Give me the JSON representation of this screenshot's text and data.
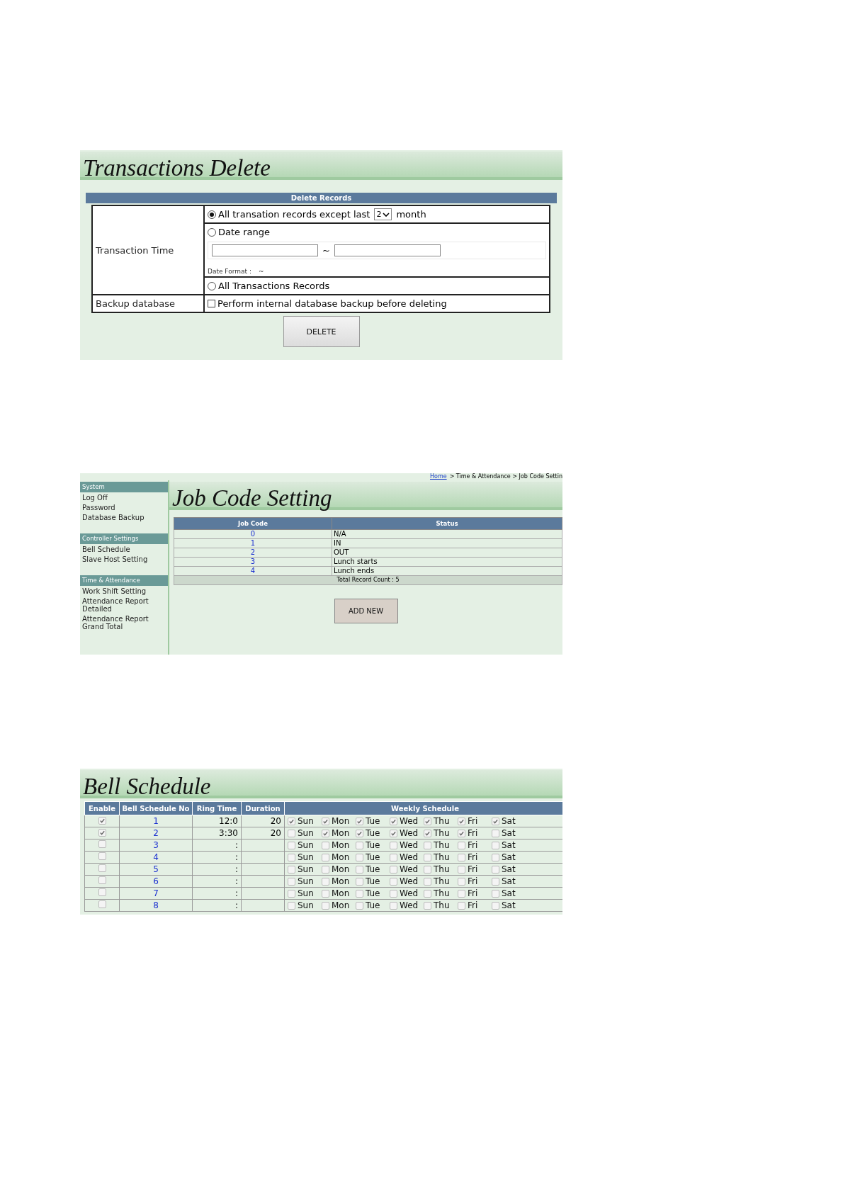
{
  "transactions_delete": {
    "title": "Transactions Delete",
    "header": "Delete Records",
    "time_label": "Transaction Time",
    "options": [
      {
        "kind": "months",
        "label": "All transation records except last",
        "select_value": "2",
        "label_after": "month",
        "selected": true
      },
      {
        "kind": "range",
        "label": "Date range",
        "separator": "~",
        "format_label": "Date Format :",
        "format_value": "~",
        "selected": false
      },
      {
        "kind": "plain",
        "label": "All Transactions Records",
        "selected": false
      }
    ],
    "backup": {
      "label": "Backup database",
      "checkbox_label": "Perform internal database backup before deleting",
      "checked": false
    },
    "button": "DELETE"
  },
  "job_code_setting": {
    "breadcrumb": {
      "home": "Home",
      "path": "> Time & Attendance > Job Code Settin"
    },
    "sidebar": [
      {
        "title": "System",
        "items": [
          "Log Off",
          "Password",
          "Database Backup"
        ]
      },
      {
        "title": "Controller Settings",
        "items": [
          "Bell Schedule",
          "Slave Host Setting"
        ]
      },
      {
        "title": "Time & Attendance",
        "items": [
          "Work Shift Setting",
          "Attendance Report Detailed",
          "Attendance Report Grand Total"
        ]
      }
    ],
    "title": "Job Code Setting",
    "columns": [
      "Job Code",
      "Status"
    ],
    "rows": [
      {
        "code": "0",
        "status": "N/A"
      },
      {
        "code": "1",
        "status": "IN"
      },
      {
        "code": "2",
        "status": "OUT"
      },
      {
        "code": "3",
        "status": "Lunch starts"
      },
      {
        "code": "4",
        "status": "Lunch ends"
      }
    ],
    "footer": "Total Record Count : 5",
    "button": "ADD NEW"
  },
  "bell_schedule": {
    "title": "Bell Schedule",
    "columns": [
      "Enable",
      "Bell Schedule No",
      "Ring Time",
      "Duration",
      "Weekly Schedule"
    ],
    "rows": [
      {
        "enabled": true,
        "no": "1",
        "ring_time": "12:0",
        "duration": "20",
        "days": [
          {
            "label": "Sun",
            "checked": true
          },
          {
            "label": "Mon",
            "checked": true
          },
          {
            "label": "Tue",
            "checked": true
          },
          {
            "label": "Wed",
            "checked": true
          },
          {
            "label": "Thu",
            "checked": true
          },
          {
            "label": "Fri",
            "checked": true
          },
          {
            "label": "Sat",
            "checked": true
          }
        ]
      },
      {
        "enabled": true,
        "no": "2",
        "ring_time": "3:30",
        "duration": "20",
        "days": [
          {
            "label": "Sun",
            "checked": false
          },
          {
            "label": "Mon",
            "checked": true
          },
          {
            "label": "Tue",
            "checked": true
          },
          {
            "label": "Wed",
            "checked": true
          },
          {
            "label": "Thu",
            "checked": true
          },
          {
            "label": "Fri",
            "checked": true
          },
          {
            "label": "Sat",
            "checked": false
          }
        ]
      },
      {
        "enabled": false,
        "no": "3",
        "ring_time": ":",
        "days": [
          {
            "label": "Sun",
            "checked": false
          },
          {
            "label": "Mon",
            "checked": false
          },
          {
            "label": "Tue",
            "checked": false
          },
          {
            "label": "Wed",
            "checked": false
          },
          {
            "label": "Thu",
            "checked": false
          },
          {
            "label": "Fri",
            "checked": false
          },
          {
            "label": "Sat",
            "checked": false
          }
        ]
      },
      {
        "enabled": false,
        "no": "4",
        "ring_time": ":",
        "days": [
          {
            "label": "Sun",
            "checked": false
          },
          {
            "label": "Mon",
            "checked": false
          },
          {
            "label": "Tue",
            "checked": false
          },
          {
            "label": "Wed",
            "checked": false
          },
          {
            "label": "Thu",
            "checked": false
          },
          {
            "label": "Fri",
            "checked": false
          },
          {
            "label": "Sat",
            "checked": false
          }
        ]
      },
      {
        "enabled": false,
        "no": "5",
        "ring_time": ":",
        "days": [
          {
            "label": "Sun",
            "checked": false
          },
          {
            "label": "Mon",
            "checked": false
          },
          {
            "label": "Tue",
            "checked": false
          },
          {
            "label": "Wed",
            "checked": false
          },
          {
            "label": "Thu",
            "checked": false
          },
          {
            "label": "Fri",
            "checked": false
          },
          {
            "label": "Sat",
            "checked": false
          }
        ]
      },
      {
        "enabled": false,
        "no": "6",
        "ring_time": ":",
        "days": [
          {
            "label": "Sun",
            "checked": false
          },
          {
            "label": "Mon",
            "checked": false
          },
          {
            "label": "Tue",
            "checked": false
          },
          {
            "label": "Wed",
            "checked": false
          },
          {
            "label": "Thu",
            "checked": false
          },
          {
            "label": "Fri",
            "checked": false
          },
          {
            "label": "Sat",
            "checked": false
          }
        ]
      },
      {
        "enabled": false,
        "no": "7",
        "ring_time": ":",
        "days": [
          {
            "label": "Sun",
            "checked": false
          },
          {
            "label": "Mon",
            "checked": false
          },
          {
            "label": "Tue",
            "checked": false
          },
          {
            "label": "Wed",
            "checked": false
          },
          {
            "label": "Thu",
            "checked": false
          },
          {
            "label": "Fri",
            "checked": false
          },
          {
            "label": "Sat",
            "checked": false
          }
        ]
      },
      {
        "enabled": false,
        "no": "8",
        "ring_time": ":",
        "days": [
          {
            "label": "Sun",
            "checked": false
          },
          {
            "label": "Mon",
            "checked": false
          },
          {
            "label": "Tue",
            "checked": false
          },
          {
            "label": "Wed",
            "checked": false
          },
          {
            "label": "Thu",
            "checked": false
          },
          {
            "label": "Fri",
            "checked": false
          },
          {
            "label": "Sat",
            "checked": false
          }
        ]
      }
    ]
  }
}
